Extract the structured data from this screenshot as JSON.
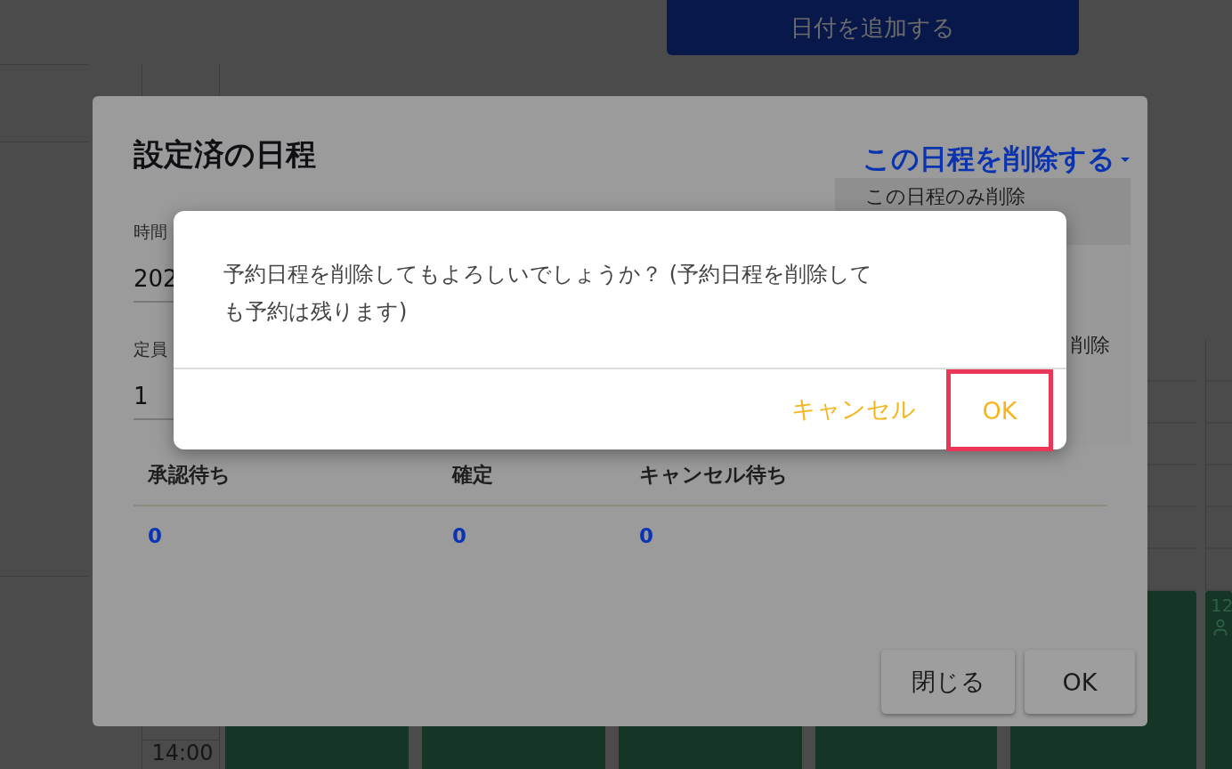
{
  "page": {
    "add_date_button": "日付を追加する",
    "time_label": "14:00",
    "edge_label": "12"
  },
  "schedule_dialog": {
    "title": "設定済の日程",
    "delete_menu": {
      "label": "この日程を削除する",
      "expanded": true,
      "items": [
        {
          "label": "この日程のみ削除",
          "selected": true
        },
        {
          "label": "削除",
          "selected": false
        }
      ]
    },
    "fields": [
      {
        "label": "時間",
        "value": "202"
      },
      {
        "label": "定員",
        "value": "1"
      }
    ],
    "table": {
      "columns": [
        "承認待ち",
        "確定",
        "キャンセル待ち"
      ],
      "rows": [
        [
          "0",
          "0",
          "0"
        ]
      ]
    },
    "buttons": [
      "閉じる",
      "OK"
    ]
  },
  "confirm_dialog": {
    "message": "予約日程を削除してもよろしいでしょうか？ (予約日程を削除しても予約は残ります)",
    "buttons": [
      {
        "label": "キャンセル",
        "highlighted": false
      },
      {
        "label": "OK",
        "highlighted": true
      }
    ]
  }
}
